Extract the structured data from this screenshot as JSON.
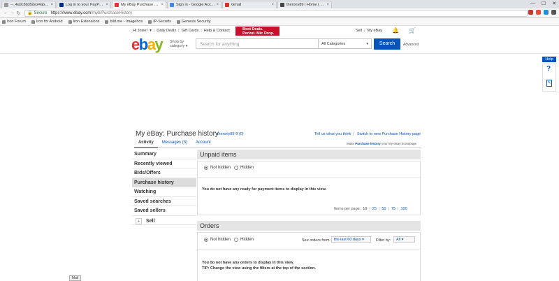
{
  "browser": {
    "tabs": [
      {
        "title": "--_4a9c8b35de24abe50c",
        "favicon_color": "#999999",
        "active": false
      },
      {
        "title": "Log in to your PayPal acc",
        "favicon_color": "#003087",
        "active": false
      },
      {
        "title": "My eBay Purchase Histor",
        "favicon_color": "#e53238",
        "active": true
      },
      {
        "title": "Sign in - Google Account",
        "favicon_color": "#4285f4",
        "active": false
      },
      {
        "title": "Gmail",
        "favicon_color": "#d93025",
        "active": false
      },
      {
        "title": "therony89 | Home | Click",
        "favicon_color": "#444444",
        "active": false
      }
    ],
    "window_controls": {
      "minimize": "—",
      "maximize": "☐",
      "close": "✕"
    },
    "nav": {
      "back": "←",
      "forward": "→",
      "reload": "↻"
    },
    "address": {
      "secure_label": "Secure",
      "host": "https://www.ebay.com",
      "path": "/myb/PurchaseHistory"
    },
    "extension_colors": [
      "#c0392b",
      "#e74c3c",
      "#2e86de",
      "#555555"
    ],
    "bookmarks": [
      "Iron Forum",
      "Iron for Android",
      "Iron Extensions",
      "bild.me - Imagehos",
      "IP-Secrets",
      "Genesis Security"
    ]
  },
  "ebay": {
    "topnav": {
      "greeting": "Hi Josie!",
      "greeting_caret": "▾",
      "links": [
        "Daily Deals",
        "Gift Cards",
        "Help & Contact"
      ],
      "right_links": [
        "Sell",
        "My eBay"
      ],
      "bell_icon": "🔔",
      "cart_icon": "🛒"
    },
    "promo": {
      "line1": "Best Deals.",
      "line2": "Period. Mic Drop."
    },
    "logo": {
      "e": "e",
      "b": "b",
      "a": "a",
      "y": "y"
    },
    "shop_by": {
      "line1": "Shop by",
      "line2": "category",
      "caret": "▾"
    },
    "search": {
      "placeholder": "Search for anything",
      "category": "All Categories",
      "category_caret": "▾",
      "button": "Search",
      "advanced": "Advanced"
    },
    "help": {
      "tab": "Help",
      "question": "?",
      "feedback_icon": "✎"
    }
  },
  "myebay": {
    "title": "My eBay: Purchase history",
    "username": "theroriy89-9 (0)",
    "tell_us": "Tell us what you think",
    "separator": "|",
    "switch": "Switch to new Purchase History page",
    "make_home": {
      "pre": "Make ",
      "bold": "Purchase history",
      "post": " your My eBay homepage"
    },
    "tabs": [
      "Activity",
      "Messages (3)",
      "Account"
    ],
    "sidenav": [
      "Summary",
      "Recently viewed",
      "Bids/Offers",
      "Purchase history",
      "Watching",
      "Saved searches",
      "Saved sellers"
    ],
    "sell": {
      "toggle": "+",
      "label": "Sell"
    },
    "unpaid": {
      "header": "Unpaid items",
      "radio_not_hidden": "Not hidden",
      "radio_hidden": "Hidden",
      "message": "You do not have any ready for payment items to display in this view.",
      "items_per_page_label": "Items per page:",
      "items_per_page": [
        "10",
        "25",
        "50",
        "75",
        "100"
      ],
      "separator": "|"
    },
    "orders": {
      "header": "Orders",
      "radio_not_hidden": "Not hidden",
      "radio_hidden": "Hidden",
      "see_orders_label": "See orders from:",
      "see_orders_value": "the last 60 days",
      "filter_label": "Filter by:",
      "filter_value": "All",
      "caret": "▾",
      "message1": "You do not have any orders to display in this view.",
      "message2": "TIP: Change the view using the filters at the top of the section."
    }
  },
  "taskbar": {
    "mail": "Mail"
  }
}
